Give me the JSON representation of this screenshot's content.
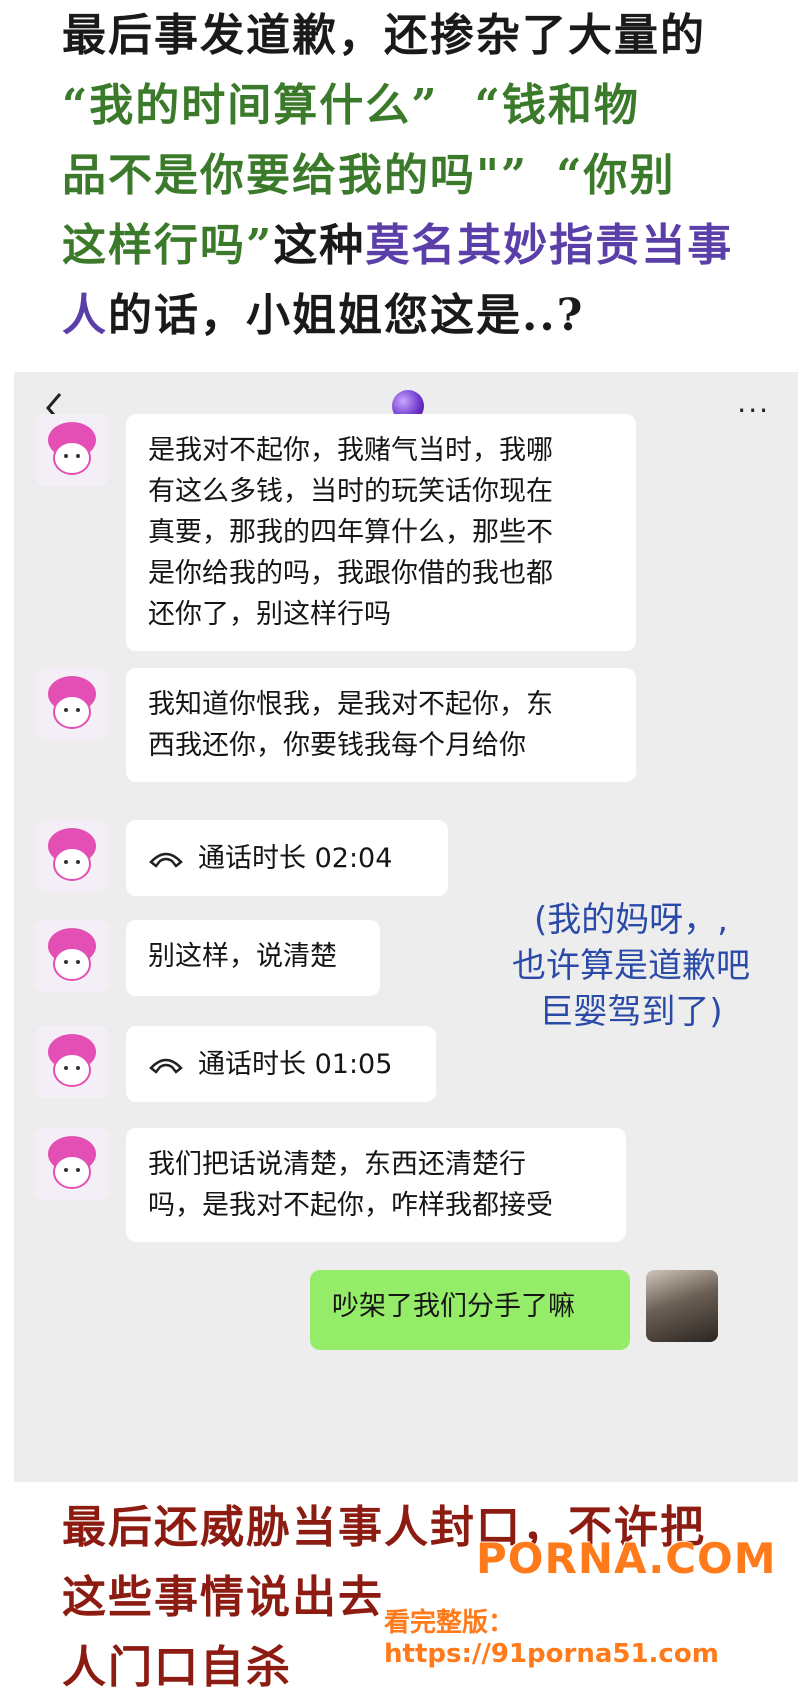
{
  "caption_top": {
    "line1": "最后事发道歉，还掺杂了大量的",
    "line2a": "“我的时间算什么”",
    "line2b": "“钱和物",
    "line3a": "品不是你要给我的吗\"”",
    "line3b": "“你别",
    "line4a": "这样行吗”",
    "line4b": "这种",
    "line4c": "莫名其妙指责当事",
    "line5a": "人",
    "line5b": "的话，小姐姐您这是..?"
  },
  "chat": {
    "header": {
      "back_icon": "chevron-left-icon",
      "contact_icon": "crystal-ball-icon",
      "more": "···"
    },
    "messages": [
      {
        "side": "left",
        "type": "text",
        "lines": [
          "是我对不起你，我赌气当时，我哪",
          "有这么多钱，当时的玩笑话你现在",
          "真要，那我的四年算什么，那些不",
          "是你给我的吗，我跟你借的我也都",
          "还你了，别这样行吗"
        ]
      },
      {
        "side": "left",
        "type": "text",
        "lines": [
          "我知道你恨我，是我对不起你，东",
          "西我还你，你要钱我每个月给你"
        ]
      },
      {
        "side": "left",
        "type": "call",
        "text": "通话时长 02:04"
      },
      {
        "side": "left",
        "type": "text",
        "lines": [
          "别这样，说清楚"
        ]
      },
      {
        "side": "left",
        "type": "call",
        "text": "通话时长 01:05"
      },
      {
        "side": "left",
        "type": "text",
        "lines": [
          "我们把话说清楚，东西还清楚行",
          "吗，是我对不起你，咋样我都接受"
        ]
      },
      {
        "side": "right",
        "type": "text",
        "lines": [
          "吵架了我们分手了嘛"
        ]
      }
    ],
    "annotation": {
      "line1": "(我的妈呀，,",
      "line2": "也许算是道歉吧",
      "line3": "巨婴驾到了)"
    }
  },
  "caption_bottom": {
    "line1": "最后还威胁当事人封口，不许把",
    "line2": "这些事情说出去",
    "line3": "人门口自杀"
  },
  "watermark": {
    "main": "PORNA.COM",
    "sub": "看完整版：https://91porna51.com"
  },
  "colors": {
    "chat_bg": "#ededed",
    "bubble_left": "#ffffff",
    "bubble_right": "#95ec69",
    "caption_green": "#3a7a2a",
    "caption_purple": "#5a3fa8",
    "caption_red": "#8c1c12",
    "annotation_blue": "#2a4aa8",
    "watermark_orange": "#ff7a1a"
  }
}
